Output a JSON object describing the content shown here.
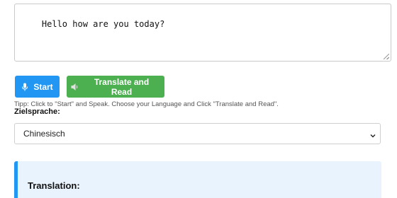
{
  "input": {
    "value": "Hello how are you today?"
  },
  "buttons": {
    "start_label": "Start",
    "start_icon": "microphone-icon",
    "translate_label": "Translate and Read",
    "translate_icon": "speaker-icon"
  },
  "tip": "Tipp: Click to \"Start\" and Speak. Choose your Language and Click \"Translate and Read\".",
  "target_language": {
    "label": "Zielsprache:",
    "selected": "Chinesisch"
  },
  "result": {
    "title": "Translation:"
  },
  "colors": {
    "start_button": "#2196f3",
    "translate_button": "#4caf50",
    "result_background": "#e8f3fe",
    "result_accent": "#2196f3"
  }
}
